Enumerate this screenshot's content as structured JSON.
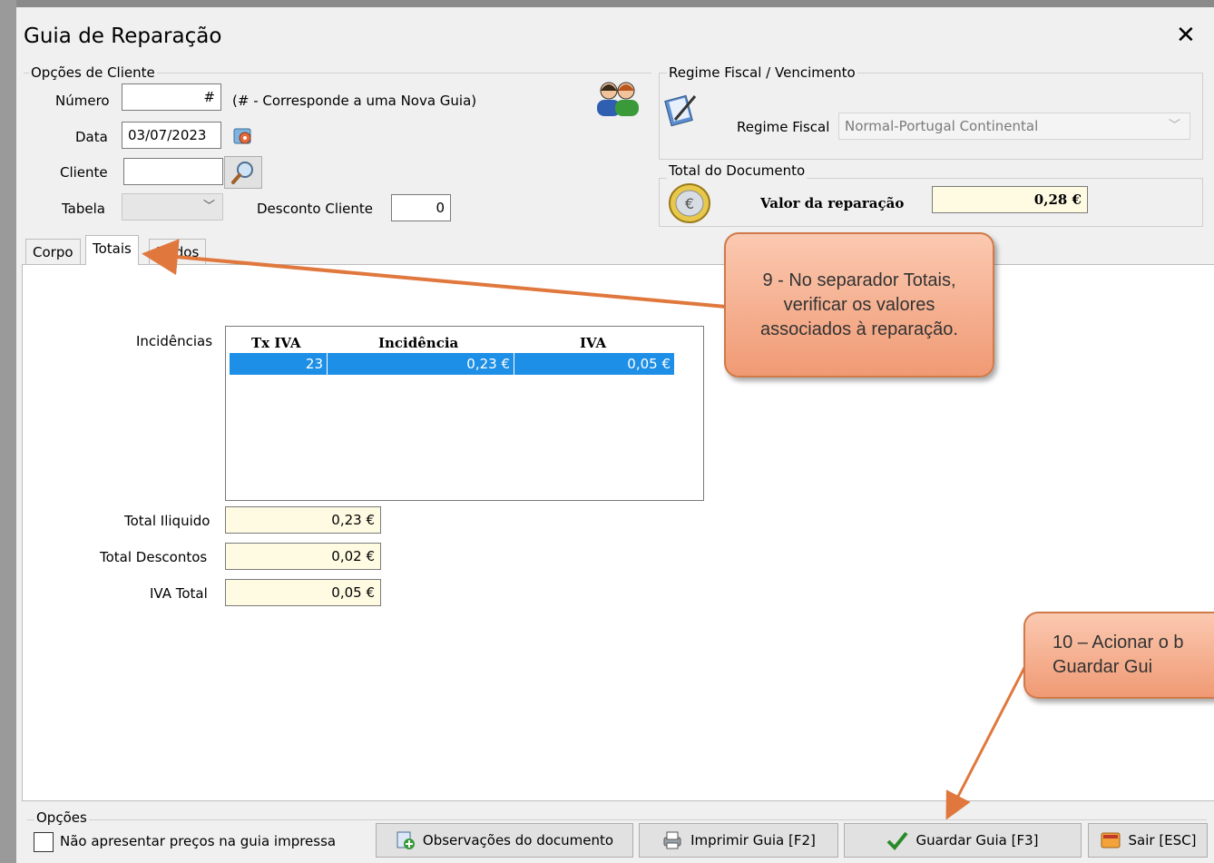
{
  "window": {
    "title": "Guia de Reparação"
  },
  "cliente": {
    "legend": "Opções de Cliente",
    "numero_label": "Número",
    "numero_value": "#",
    "numero_hint": "(# - Corresponde a uma Nova Guia)",
    "data_label": "Data",
    "data_value": "03/07/2023",
    "cliente_label": "Cliente",
    "cliente_value": "",
    "tabela_label": "Tabela",
    "tabela_value": "",
    "desconto_label": "Desconto Cliente",
    "desconto_value": "0"
  },
  "fiscal": {
    "legend": "Regime Fiscal / Vencimento",
    "regime_label": "Regime Fiscal",
    "regime_value": "Normal-Portugal Continental"
  },
  "total_doc": {
    "legend": "Total do Documento",
    "valor_label": "Valor da reparação",
    "valor_value": "0,28 €"
  },
  "tabs": [
    {
      "label": "Corpo",
      "active": false
    },
    {
      "label": "Totais",
      "active": true
    },
    {
      "label": "Dados",
      "active": false
    }
  ],
  "totais": {
    "incidencias_label": "Incidências",
    "columns": [
      "Tx IVA",
      "Incidência",
      "IVA"
    ],
    "rows": [
      {
        "tx": "23",
        "incidencia": "0,23 €",
        "iva": "0,05 €"
      }
    ],
    "total_iliquido_label": "Total Iliquido",
    "total_iliquido_value": "0,23 €",
    "total_descontos_label": "Total Descontos",
    "total_descontos_value": "0,02 €",
    "iva_total_label": "IVA Total",
    "iva_total_value": "0,05 €"
  },
  "callouts": {
    "c9": "9 - No separador Totais, verificar os valores associados à reparação.",
    "c10": "10 – Acionar o b Guardar Gui"
  },
  "opcoes": {
    "legend": "Opções",
    "checkbox_label": "Não apresentar preços na guia impressa",
    "checkbox_checked": false,
    "obs_btn": "Observações do documento",
    "imprimir_btn": "Imprimir Guia [F2]",
    "guardar_btn": "Guardar Guia [F3]",
    "sair_btn": "Sair [ESC]"
  },
  "colors": {
    "selection": "#1e8fe6",
    "callout": "#f4a682",
    "arrow": "#e0783e",
    "total_field": "#fffbe3"
  }
}
